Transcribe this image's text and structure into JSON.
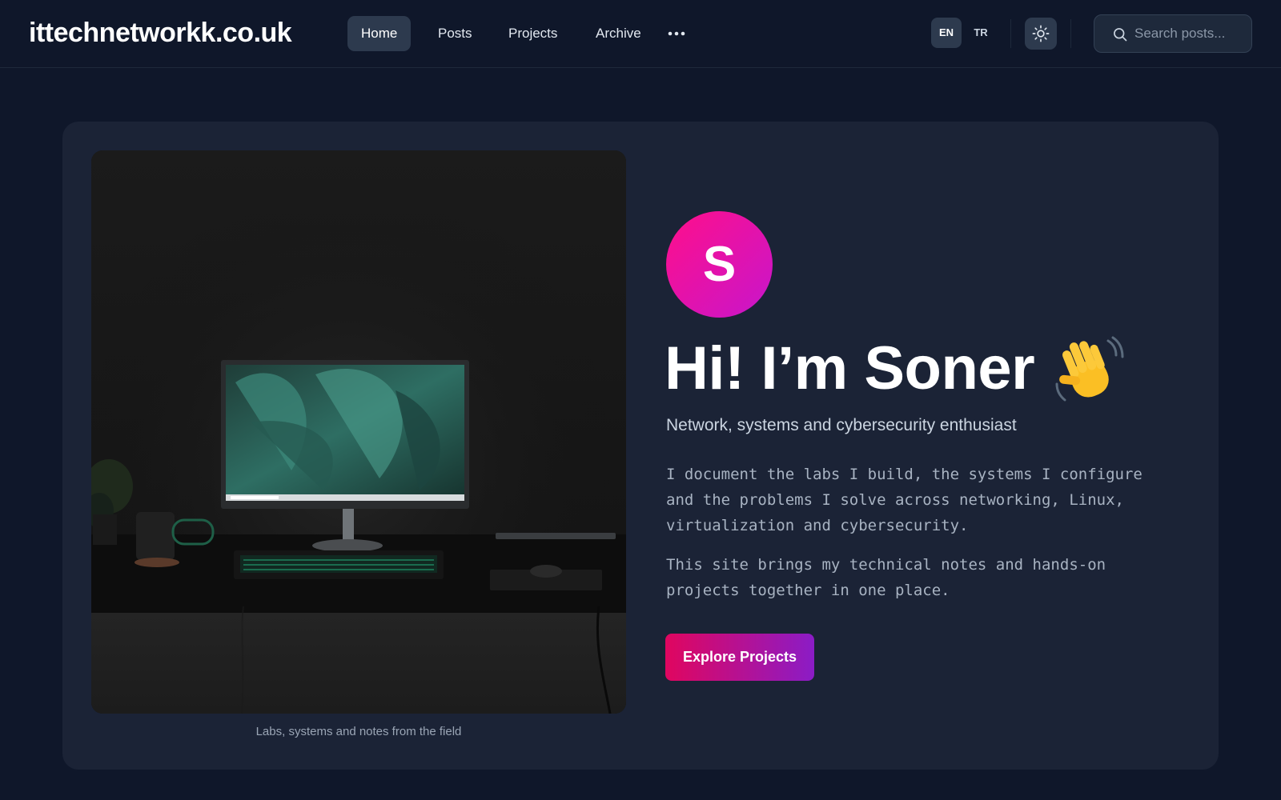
{
  "header": {
    "site_name": "ittechnetworkk.co.uk",
    "nav": [
      {
        "label": "Home",
        "active": true
      },
      {
        "label": "Posts"
      },
      {
        "label": "Projects"
      },
      {
        "label": "Archive"
      }
    ],
    "more_icon": "ellipsis-icon",
    "languages": [
      "EN",
      "TR"
    ],
    "active_language": "EN",
    "theme_icon": "sun-icon",
    "search": {
      "placeholder": "Search posts...",
      "value": "",
      "icon": "search-icon"
    }
  },
  "hero": {
    "image_caption": "Labs, systems and notes from the field",
    "avatar_initial": "S",
    "title": "Hi! I’m Soner",
    "title_icon": "waving-hand-icon",
    "subtitle": "Network, systems and cybersecurity enthusiast",
    "paragraphs": [
      "I document the labs I build, the systems I configure and the problems I solve across networking, Linux, virtualization and cybersecurity.",
      "This site brings my technical notes and hands-on projects together in one place."
    ],
    "cta_label": "Explore Projects"
  },
  "colors": {
    "background": "#0f172a",
    "card": "#1b2336",
    "accent_pink": "#ff0f8a",
    "accent_purple": "#8b1cc6"
  }
}
